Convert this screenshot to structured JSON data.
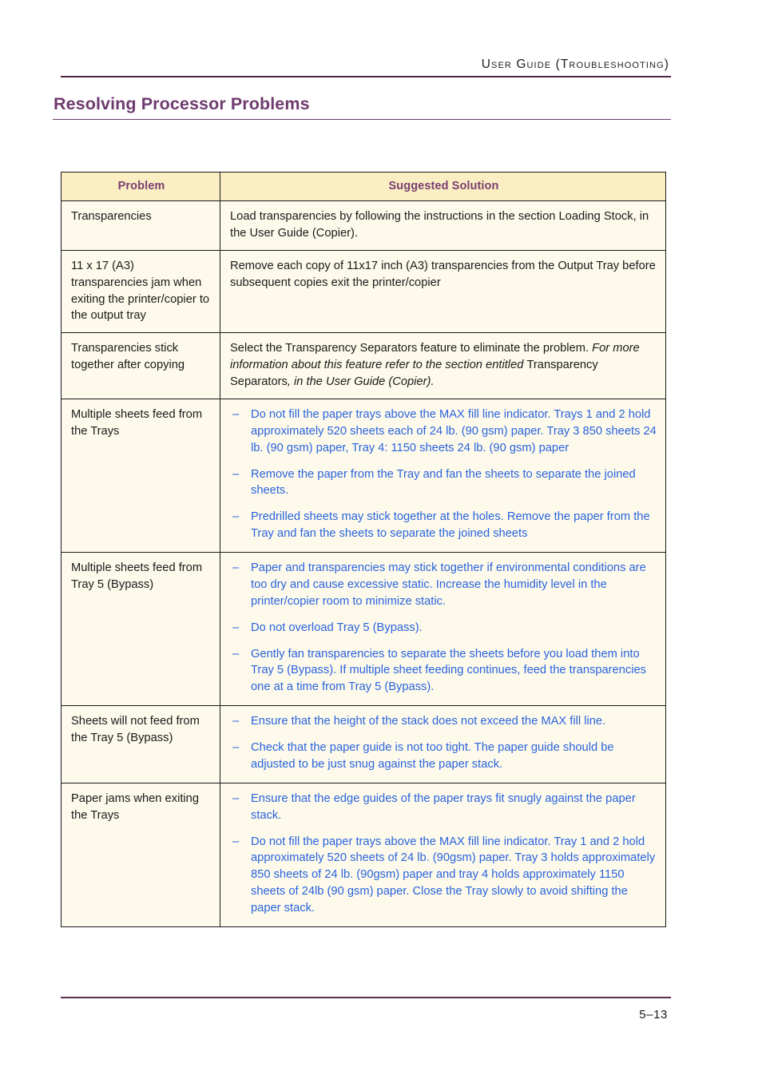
{
  "header": {
    "running_head": "User Guide (Troubleshooting)",
    "rule_color": "#4a2545"
  },
  "title": {
    "text": "Resolving Processor Problems",
    "color": "#6e3b6e"
  },
  "colors": {
    "accent_purple": "#6e3b6e",
    "header_row_bg": "#fbeec2",
    "body_row_bg": "#fdfaeb",
    "bullet_blue": "#2a63dd",
    "border": "#1a1a1a"
  },
  "table": {
    "columns": [
      {
        "label": "Problem"
      },
      {
        "label": "Suggested Solution"
      }
    ],
    "rows": [
      {
        "problem": "Transparencies",
        "solution_type": "paragraphs",
        "paragraphs": [
          {
            "runs": [
              {
                "text": "Load transparencies by following the instructions in the section Loading Stock, in the User Guide (Copier).",
                "style": "normal"
              }
            ]
          }
        ]
      },
      {
        "problem": "11 x 17 (A3) transparencies jam when exiting the printer/copier to the output tray",
        "solution_type": "paragraphs",
        "paragraphs": [
          {
            "runs": [
              {
                "text": "Remove each copy of 11x17 inch (A3) transparencies from the Output Tray before subsequent copies exit the printer/copier",
                "style": "normal"
              }
            ]
          }
        ]
      },
      {
        "problem": "Transparencies stick together after copying",
        "solution_type": "paragraphs",
        "paragraphs": [
          {
            "runs": [
              {
                "text": "Select the Transparency Separators feature to eliminate the problem. ",
                "style": "normal"
              },
              {
                "text": "For more information about this feature refer to the section entitled ",
                "style": "italic"
              },
              {
                "text": "Transparency Separators",
                "style": "normal"
              },
              {
                "text": ", in the User Guide (Copier).",
                "style": "italic"
              }
            ]
          }
        ]
      },
      {
        "problem": "Multiple sheets feed from the Trays",
        "solution_type": "bullets",
        "bullets": [
          "Do not fill the paper trays above the MAX fill line indicator. Trays 1 and 2 hold approximately 520 sheets each of 24 lb. (90 gsm) paper. Tray 3 850 sheets 24 lb. (90 gsm) paper, Tray 4: 1150 sheets 24 lb. (90 gsm) paper",
          "Remove the paper from the Tray and fan the sheets to separate the joined sheets.",
          "Predrilled sheets may stick together at the holes. Remove the paper from the Tray and fan the sheets to separate the joined sheets"
        ]
      },
      {
        "problem": "Multiple sheets feed from Tray 5 (Bypass)",
        "solution_type": "bullets",
        "bullets": [
          "Paper and transparencies may stick together if environmental conditions are too dry and cause excessive static. Increase the humidity level in the printer/copier room to minimize static.",
          "Do not overload Tray 5 (Bypass).",
          "Gently fan transparencies to separate the sheets before you load them into Tray 5 (Bypass). If multiple sheet feeding continues, feed the transparencies one at a time from Tray 5 (Bypass)."
        ]
      },
      {
        "problem": "Sheets will not feed from the Tray 5 (Bypass)",
        "solution_type": "bullets",
        "bullets": [
          "Ensure that the height of the stack does not exceed the MAX fill line.",
          "Check that the paper guide is not too tight. The paper guide should be adjusted to be just snug against the paper stack."
        ]
      },
      {
        "problem": "Paper jams when exiting the Trays",
        "solution_type": "bullets",
        "bullets": [
          "Ensure that the edge guides of the paper trays fit snugly against the paper stack.",
          "Do not fill the paper trays above the MAX fill line indicator. Tray 1 and 2 hold approximately 520 sheets of 24 lb. (90gsm) paper. Tray 3 holds approximately 850 sheets of 24 lb. (90gsm) paper and tray 4 holds approximately 1150 sheets of 24lb (90 gsm) paper. Close the Tray slowly to avoid shifting the paper stack."
        ]
      }
    ],
    "bullet_marker": "–"
  },
  "footer": {
    "page_number": "5–13"
  }
}
